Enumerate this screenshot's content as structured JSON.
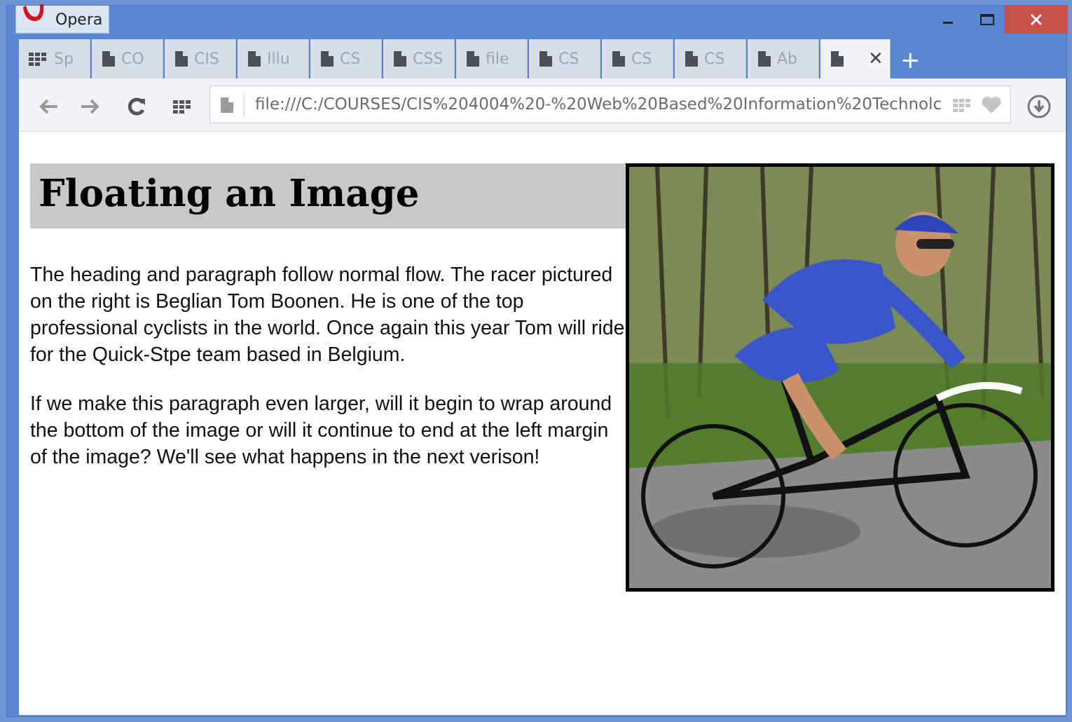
{
  "window": {
    "app_name": "Opera",
    "minimize_icon": "minimize-icon",
    "maximize_icon": "maximize-icon",
    "close_icon": "close-icon"
  },
  "tabs": [
    {
      "label": "Sp",
      "icon": "speed-dial-icon"
    },
    {
      "label": "CO",
      "icon": "page-icon"
    },
    {
      "label": "CIS",
      "icon": "page-icon"
    },
    {
      "label": "Illu",
      "icon": "page-icon"
    },
    {
      "label": "CS",
      "icon": "page-icon"
    },
    {
      "label": "CSS",
      "icon": "page-icon"
    },
    {
      "label": "file",
      "icon": "page-icon"
    },
    {
      "label": "CS",
      "icon": "page-icon"
    },
    {
      "label": "CS",
      "icon": "page-icon"
    },
    {
      "label": "CS",
      "icon": "page-icon"
    },
    {
      "label": "Ab",
      "icon": "page-icon"
    },
    {
      "label": "",
      "icon": "page-icon",
      "active": true
    }
  ],
  "new_tab_label": "+",
  "address_bar": {
    "url": "file:///C:/COURSES/CIS%204004%20-%20Web%20Based%20Information%20Technolc"
  },
  "content": {
    "heading": "Floating an Image",
    "paragraph1": "The heading and paragraph follow normal flow. The racer pictured on the right is Beglian Tom Boonen. He is one of the top professional cyclists in the world. Once again this year Tom will ride for the Quick-Stpe team based in Belgium.",
    "paragraph2": "If we make this paragraph even larger, will it begin to wrap around the bottom of the image or will it continue to end at the left margin of the image? We'll see what happens in the next verison!"
  },
  "colors": {
    "frame": "#5b86d2",
    "close_button": "#c9504a",
    "heading_background": "#c8c8c8"
  }
}
